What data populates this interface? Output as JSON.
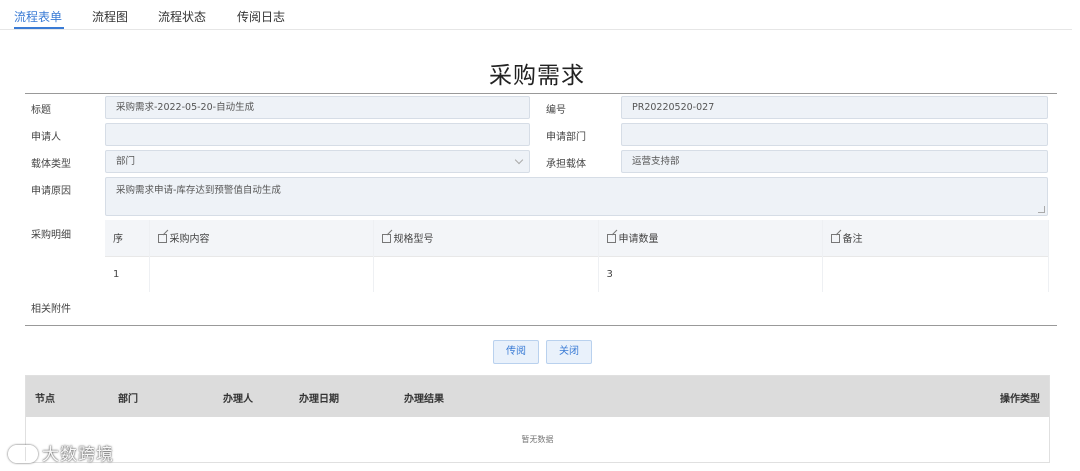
{
  "tabs": [
    {
      "label": "流程表单"
    },
    {
      "label": "流程图"
    },
    {
      "label": "流程状态"
    },
    {
      "label": "传阅日志"
    }
  ],
  "form": {
    "title": "采购需求",
    "fields": {
      "title_label": "标题",
      "title_value": "采购需求-2022-05-20-自动生成",
      "number_label": "编号",
      "number_value": "PR20220520-027",
      "applicant_label": "申请人",
      "applicant_value": "",
      "dept_label": "申请部门",
      "dept_value": "",
      "carrier_type_label": "载体类型",
      "carrier_type_value": "部门",
      "carrier_label": "承担载体",
      "carrier_value": "运营支持部",
      "reason_label": "申请原因",
      "reason_value": "采购需求申请-库存达到预警值自动生成",
      "details_label": "采购明细",
      "attachments_label": "相关附件"
    },
    "details_table": {
      "headers": [
        "序",
        "采购内容",
        "规格型号",
        "申请数量",
        "备注"
      ],
      "rows": [
        {
          "index": "1",
          "content": "",
          "spec": "",
          "quantity": "3",
          "note": ""
        }
      ]
    }
  },
  "actions": {
    "circulate_label": "传阅",
    "close_label": "关闭"
  },
  "log": {
    "headers": [
      "节点",
      "部门",
      "办理人",
      "办理日期",
      "办理结果",
      "操作类型"
    ],
    "empty_text": "暂无数据"
  },
  "watermark": "大数跨境",
  "colors": {
    "accent": "#3a7bd5",
    "field_bg": "#eef2f7",
    "log_header_bg": "#dcdcdc"
  }
}
